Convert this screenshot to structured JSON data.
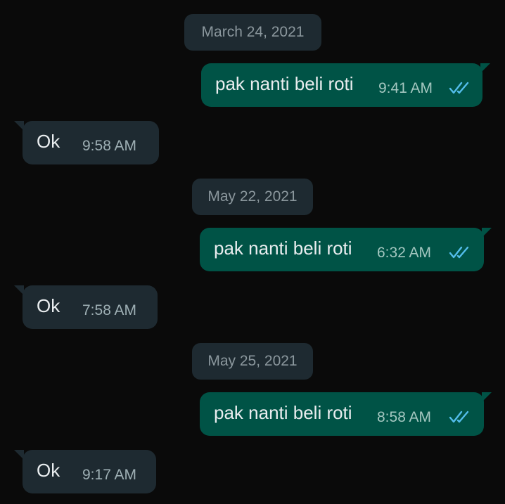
{
  "chat": {
    "dates": [
      "March 24, 2021",
      "May 22, 2021",
      "May 25, 2021"
    ],
    "messages": [
      {
        "direction": "outgoing",
        "text": "pak nanti beli roti",
        "time": "9:41 AM",
        "status": "read"
      },
      {
        "direction": "incoming",
        "text": "Ok",
        "time": "9:58 AM"
      },
      {
        "direction": "outgoing",
        "text": "pak nanti beli roti",
        "time": "6:32 AM",
        "status": "read"
      },
      {
        "direction": "incoming",
        "text": "Ok",
        "time": "7:58 AM"
      },
      {
        "direction": "outgoing",
        "text": "pak nanti beli roti",
        "time": "8:58 AM",
        "status": "read"
      },
      {
        "direction": "incoming",
        "text": "Ok",
        "time": "9:17 AM"
      }
    ]
  },
  "colors": {
    "background": "#0a0a0a",
    "outgoing_bubble": "#005346",
    "incoming_bubble": "#1e2a31",
    "read_ticks": "#53bdeb"
  }
}
